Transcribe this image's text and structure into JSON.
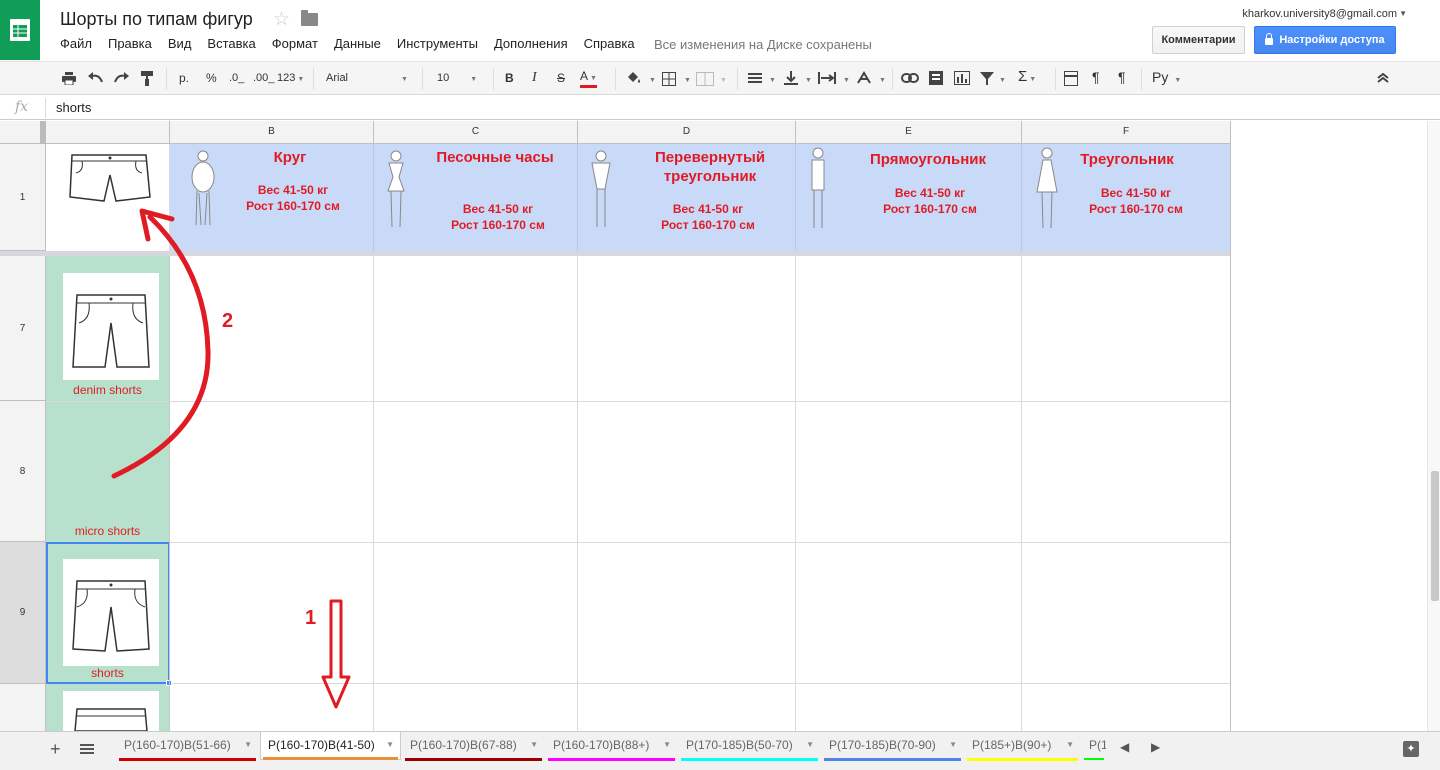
{
  "header": {
    "title": "Шорты по типам фигур",
    "save_status": "Все изменения на Диске сохранены",
    "account": "kharkov.university8@gmail.com",
    "comments_label": "Комментарии",
    "share_label": "Настройки доступа"
  },
  "menu": [
    "Файл",
    "Правка",
    "Вид",
    "Вставка",
    "Формат",
    "Данные",
    "Инструменты",
    "Дополнения",
    "Справка"
  ],
  "toolbar": {
    "currency": "р.",
    "percent": "%",
    "dec_decrease": ".0_",
    "dec_increase": ".00_",
    "number_format": "123",
    "font": "Arial",
    "font_size": "10",
    "bold": "B",
    "italic": "I",
    "strike": "S",
    "text_color": "A",
    "sum": "Σ",
    "input_lang": "Ру"
  },
  "formula_bar": {
    "fx": "fx",
    "value": "shorts"
  },
  "columns": [
    "B",
    "C",
    "D",
    "E",
    "F"
  ],
  "rows": [
    "1",
    "7",
    "8",
    "9"
  ],
  "header_row": [
    {
      "title": "Круг",
      "weight": "Вес 41-50 кг",
      "height": "Рост 160-170 см"
    },
    {
      "title": "Песочные часы",
      "weight": "Вес 41-50 кг",
      "height": "Рост 160-170 см"
    },
    {
      "title": "Перевернутый треугольник",
      "weight": "Вес 41-50 кг",
      "height": "Рост 160-170 см"
    },
    {
      "title": "Прямоугольник",
      "weight": "Вес 41-50 кг",
      "height": "Рост 160-170 см"
    },
    {
      "title": "Треугольник",
      "weight": "Вес 41-50 кг",
      "height": "Рост 160-170 см"
    }
  ],
  "column_a": {
    "row7_label": "denim shorts",
    "row8_label": "micro shorts",
    "row9_label": "shorts"
  },
  "annotations": {
    "arrow1": "1",
    "arrow2": "2",
    "color": "#e01b24"
  },
  "sheet_tabs": [
    {
      "label": "Р(160-170)В(51-66)",
      "color": "#cc0000"
    },
    {
      "label": "Р(160-170)В(41-50)",
      "color": "#e69138",
      "active": true
    },
    {
      "label": "Р(160-170)В(67-88)",
      "color": "#990000"
    },
    {
      "label": "Р(160-170)В(88+)",
      "color": "#ff00ff"
    },
    {
      "label": "Р(170-185)В(50-70)",
      "color": "#00ffff"
    },
    {
      "label": "Р(170-185)В(70-90)",
      "color": "#4a86e8"
    },
    {
      "label": "Р(185+)В(90+)",
      "color": "#ffff00"
    },
    {
      "label": "Р(1",
      "color": "#00ff00"
    }
  ],
  "colors": {
    "brand": "#0f9d58",
    "band": "#c9daf8",
    "green_cells": "#b7e1cd",
    "share_button": "#4d90fe"
  }
}
